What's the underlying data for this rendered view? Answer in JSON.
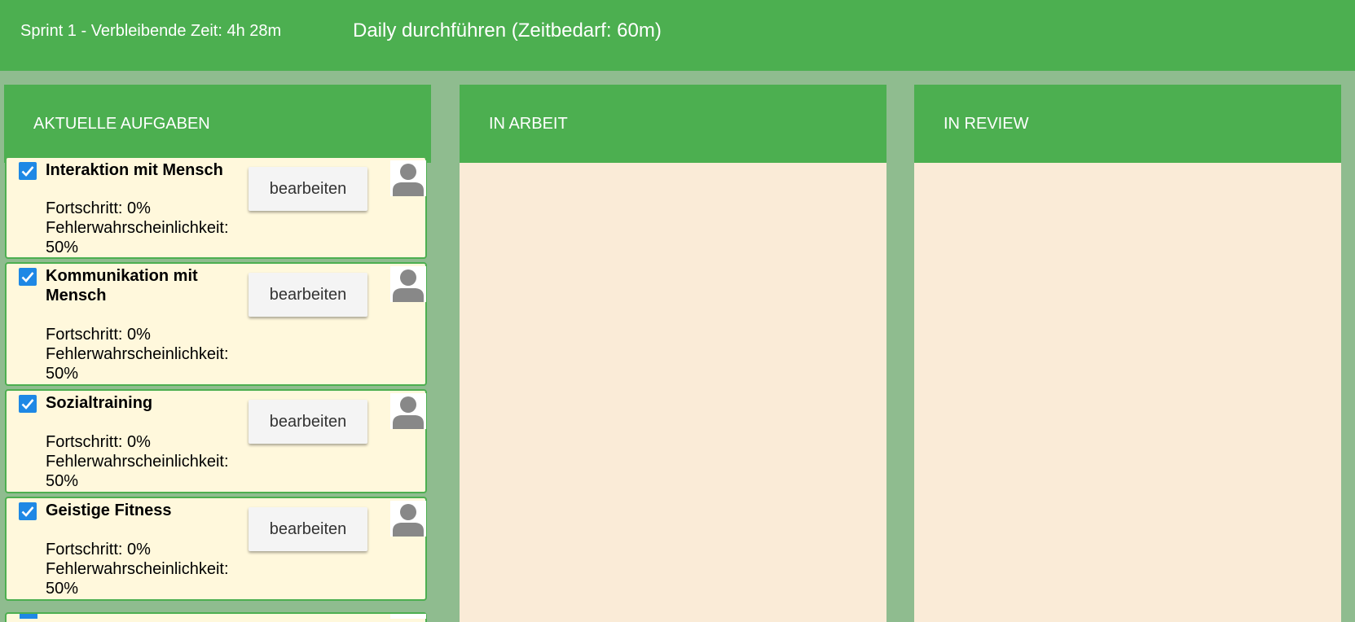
{
  "header": {
    "sprint_info": "Sprint 1 - Verbleibende Zeit: 4h 28m",
    "daily_action": "Daily durchführen (Zeitbedarf: 60m)"
  },
  "columns": [
    {
      "title": "AKTUELLE AUFGABEN"
    },
    {
      "title": "IN ARBEIT"
    },
    {
      "title": "IN REVIEW"
    }
  ],
  "tasks": [
    {
      "title": "Interaktion mit Mensch",
      "progress": "Fortschritt: 0%",
      "error_label": "Fehlerwahrscheinlichkeit:",
      "error_value": "50%",
      "edit_label": "bearbeiten",
      "checked": true
    },
    {
      "title": "Kommunikation mit Mensch",
      "progress": "Fortschritt: 0%",
      "error_label": "Fehlerwahrscheinlichkeit:",
      "error_value": "50%",
      "edit_label": "bearbeiten",
      "checked": true
    },
    {
      "title": "Sozialtraining",
      "progress": "Fortschritt: 0%",
      "error_label": "Fehlerwahrscheinlichkeit:",
      "error_value": "50%",
      "edit_label": "bearbeiten",
      "checked": true
    },
    {
      "title": "Geistige Fitness",
      "progress": "Fortschritt: 0%",
      "error_label": "Fehlerwahrscheinlichkeit:",
      "error_value": "50%",
      "edit_label": "bearbeiten",
      "checked": true
    }
  ],
  "colors": {
    "primary_green": "#4caf50",
    "background_green": "#8fbc8f",
    "card_background": "#fff8dc",
    "column_background": "#faebd7",
    "checkbox_blue": "#1e88e5",
    "avatar_gray": "#888888"
  },
  "icons": {
    "checkbox": "checkbox-checked-icon",
    "avatar": "user-avatar-icon"
  }
}
